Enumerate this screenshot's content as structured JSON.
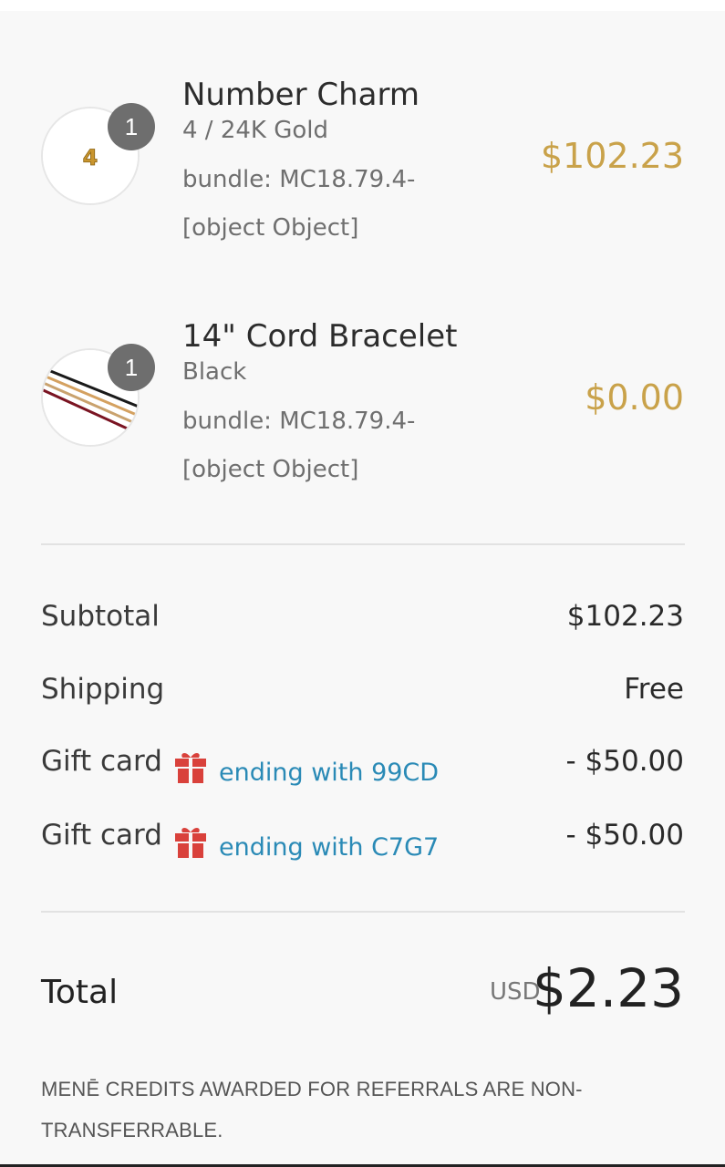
{
  "items": [
    {
      "name": "Number Charm",
      "variant": "4 / 24K Gold",
      "bundle": "bundle: MC18.79.4-[object Object]",
      "quantity": "1",
      "price": "$102.23",
      "image_icon": "gold-number-4-charm"
    },
    {
      "name": "14\" Cord Bracelet",
      "variant": "Black",
      "bundle": "bundle: MC18.79.4-[object Object]",
      "quantity": "1",
      "price": "$0.00",
      "image_icon": "cord-bracelets"
    }
  ],
  "summary": {
    "subtotal_label": "Subtotal",
    "subtotal_value": "$102.23",
    "shipping_label": "Shipping",
    "shipping_value": "Free",
    "gift_cards": [
      {
        "label": "Gift card",
        "code": "ending with 99CD",
        "amount": "- $50.00",
        "icon": "gift-icon"
      },
      {
        "label": "Gift card",
        "code": "ending with C7G7",
        "amount": "- $50.00",
        "icon": "gift-icon"
      }
    ]
  },
  "total": {
    "label": "Total",
    "currency": "USD",
    "amount": "$2.23"
  },
  "note": "MENĒ CREDITS AWARDED FOR REFERRALS ARE NON-TRANSFERRABLE.",
  "colors": {
    "price_gold": "#c9a24a",
    "gift_red": "#d9413b",
    "link_blue": "#2a8ab6",
    "quantity_badge": "#6e6e6e"
  }
}
